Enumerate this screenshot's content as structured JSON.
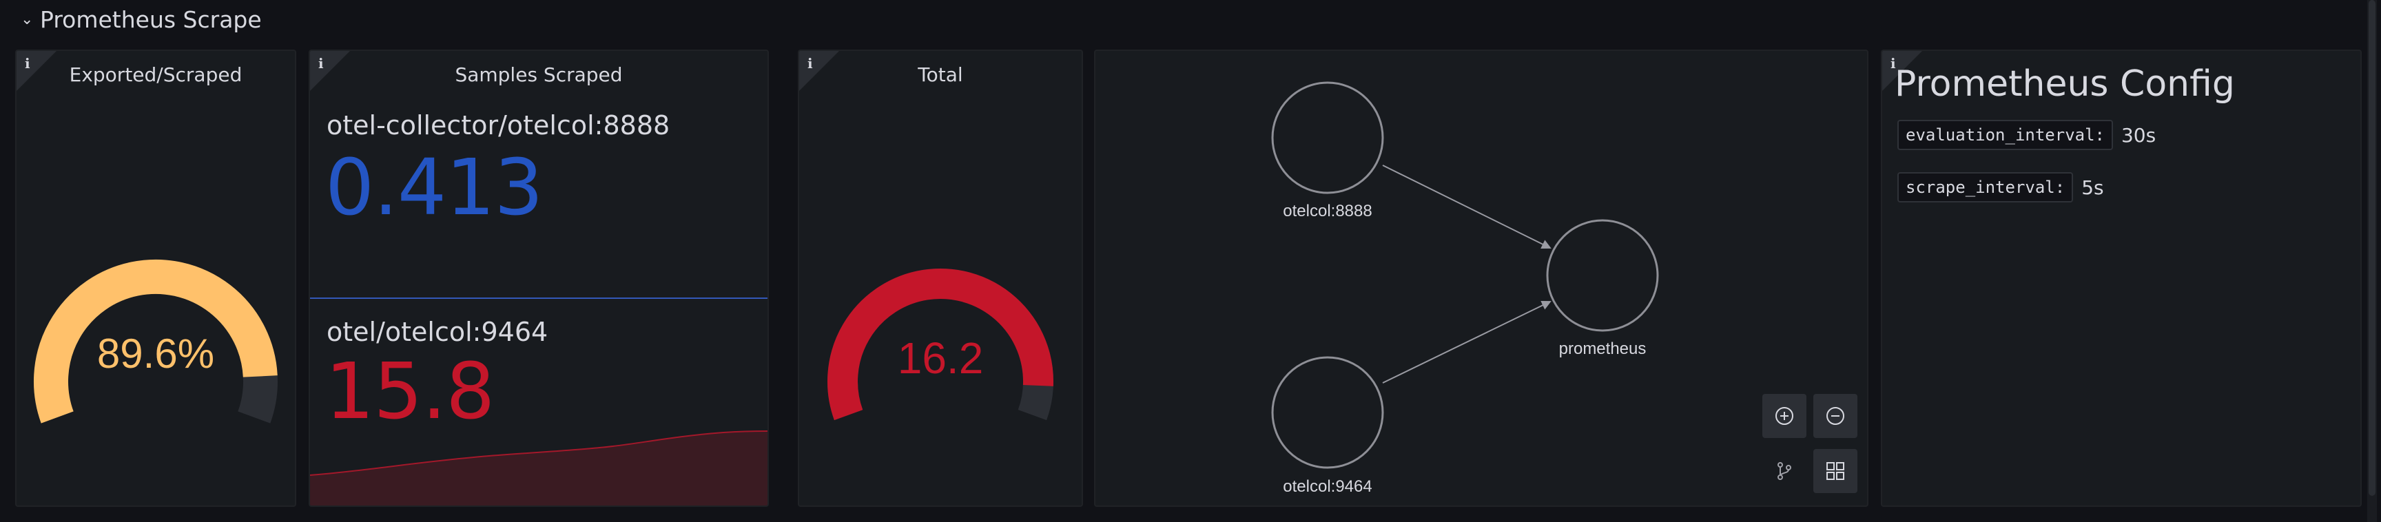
{
  "row": {
    "title": "Prometheus Scrape"
  },
  "panels": {
    "exported": {
      "title": "Exported/Scraped",
      "value_text": "89.6%",
      "fraction": 0.896,
      "color": "#ffc16b"
    },
    "samples": {
      "title": "Samples Scraped",
      "items": [
        {
          "label": "otel-collector/otelcol:8888",
          "value": "0.413",
          "color": "#2455c3"
        },
        {
          "label": "otel/otelcol:9464",
          "value": "15.8",
          "color": "#c4162a"
        }
      ]
    },
    "total": {
      "title": "Total",
      "value_text": "16.2",
      "fraction": 0.92,
      "color": "#c4162a"
    },
    "graph": {
      "nodes": [
        {
          "label": "otelcol:8888"
        },
        {
          "label": "otelcol:9464"
        },
        {
          "label": "prometheus"
        }
      ]
    },
    "config": {
      "title": "Prometheus Config",
      "entries": [
        {
          "key": "evaluation_interval:",
          "value": "30s"
        },
        {
          "key": "scrape_interval:",
          "value": "5s"
        }
      ]
    }
  }
}
